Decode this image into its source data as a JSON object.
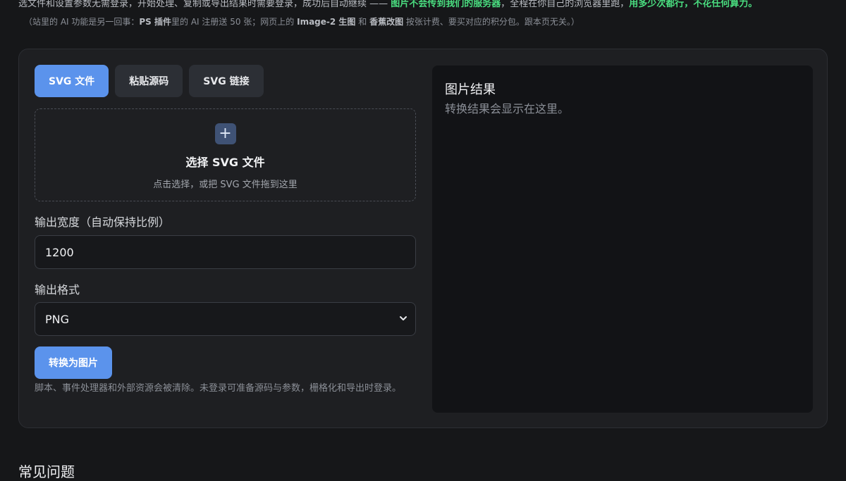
{
  "intro": {
    "text_a": "选文件和设置参数无需登录，开始处理、复制或导出结果时需要登录，成功后自动继续 —— ",
    "text_b": "图片不会传到我们的服务器",
    "text_c": "，全程在你自己的浏览器里跑，",
    "text_d": "用多少次都行，不花任何算力。"
  },
  "note": {
    "p1": "（站里的 AI 功能是另一回事：",
    "b1": "PS 插件",
    "p2": "里的 AI 注册送 50 张；网页上的 ",
    "b2": "Image-2 生图",
    "p3": " 和 ",
    "b3": "香蕉改图",
    "p4": " 按张计费、要买对应的积分包。跟本页无关。）"
  },
  "tabs": [
    {
      "label": "SVG 文件",
      "active": true
    },
    {
      "label": "粘贴源码",
      "active": false
    },
    {
      "label": "SVG 链接",
      "active": false
    }
  ],
  "upload": {
    "icon": "plus-icon",
    "title": "选择 SVG 文件",
    "hint": "点击选择，或把 SVG 文件拖到这里"
  },
  "width": {
    "label": "输出宽度（自动保持比例）",
    "value": "1200"
  },
  "format": {
    "label": "输出格式",
    "value": "PNG"
  },
  "convert_label": "转换为图片",
  "footnote": "脚本、事件处理器和外部资源会被清除。未登录可准备源码与参数，栅格化和导出时登录。",
  "result": {
    "title": "图片结果",
    "empty": "转换结果会显示在这里。"
  },
  "faq_title": "常见问题",
  "colors": {
    "accent": "#5b93ec",
    "highlight": "#4ade80",
    "background": "#161719",
    "card": "#1e1f22"
  }
}
